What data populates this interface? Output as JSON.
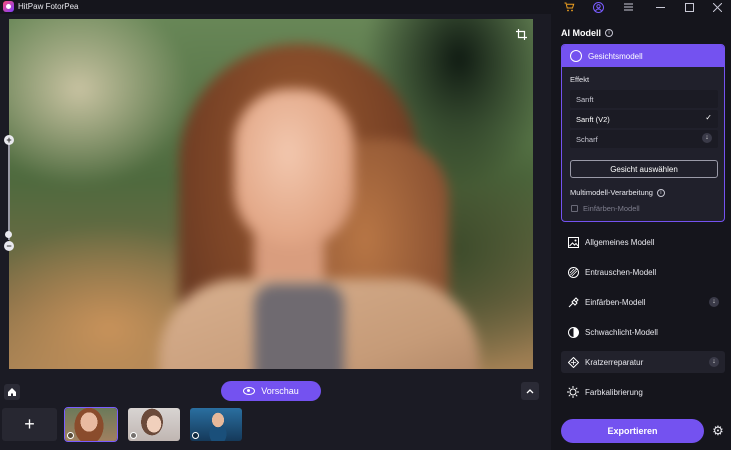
{
  "window": {
    "title": "HitPaw FotorPea",
    "icons": [
      "cart-icon",
      "user-icon",
      "menu-icon",
      "minimize-icon",
      "maximize-icon",
      "close-icon"
    ]
  },
  "canvas": {
    "icons": [
      "crop-icon",
      "zoom-in-icon",
      "zoom-out-icon"
    ]
  },
  "toolbar": {
    "preview_label": "Vorschau",
    "add_symbol": "+"
  },
  "panel": {
    "title": "AI Modell",
    "active_model": {
      "name": "Gesichtsmodell",
      "effect_label": "Effekt",
      "options": [
        "Sanft",
        "Sanft (V2)",
        "Scharf"
      ],
      "selected": "Sanft (V2)",
      "select_face_label": "Gesicht auswählen",
      "multimodel_label": "Multimodell-Verarbeitung",
      "checkbox_label": "Einfärben-Modell"
    },
    "models": [
      {
        "label": "Allgemeines Modell",
        "icon": "image-icon"
      },
      {
        "label": "Entrauschen-Modell",
        "icon": "denoise-icon"
      },
      {
        "label": "Einfärben-Modell",
        "icon": "colorize-icon"
      },
      {
        "label": "Schwachlicht-Modell",
        "icon": "lowlight-icon"
      },
      {
        "label": "Kratzerreparatur",
        "icon": "scratch-icon"
      },
      {
        "label": "Farbkalibrierung",
        "icon": "calibrate-icon"
      }
    ],
    "export_label": "Exportieren"
  },
  "colors": {
    "accent": "#7452f0",
    "background": "#1b1b24",
    "panel": "#15151c"
  }
}
